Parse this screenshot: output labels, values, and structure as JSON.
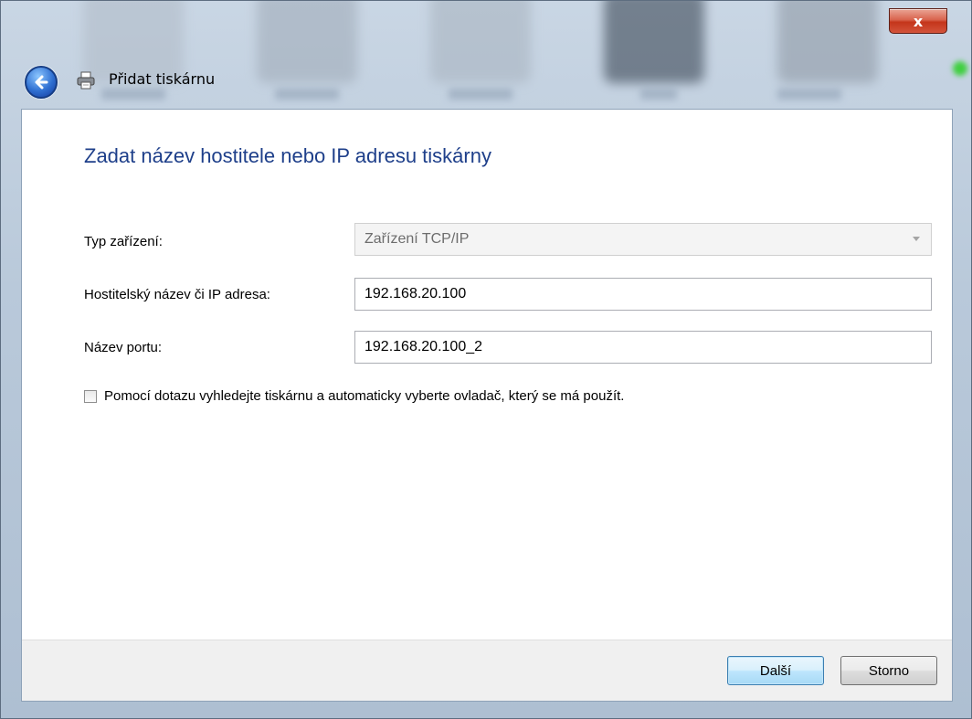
{
  "window": {
    "title": "Přidat tiskárnu",
    "close_label": "x"
  },
  "icons": {
    "back": "back-arrow-icon",
    "printer": "printer-icon"
  },
  "heading": "Zadat název hostitele nebo IP adresu tiskárny",
  "form": {
    "device_type": {
      "label": "Typ zařízení:",
      "value": "Zařízení TCP/IP"
    },
    "hostname": {
      "label": "Hostitelský název či IP adresa:",
      "value": "192.168.20.100"
    },
    "port_name": {
      "label": "Název portu:",
      "value": "192.168.20.100_2"
    },
    "auto_query": {
      "label": "Pomocí dotazu vyhledejte tiskárnu a automaticky vyberte ovladač, který se má použít.",
      "checked": false
    }
  },
  "buttons": {
    "next": "Další",
    "cancel": "Storno"
  },
  "colors": {
    "heading": "#1e3f8a",
    "close_button": "#c4351b"
  }
}
